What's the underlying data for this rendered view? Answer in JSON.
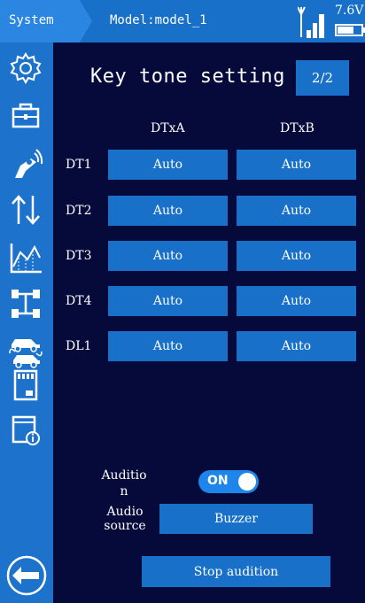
{
  "topbar": {
    "system_label": "System",
    "model_label": "Model:model_1",
    "voltage": "7.6V",
    "signal_icon": "signal-icon",
    "battery_icon": "battery-icon"
  },
  "sidebar": {
    "items": [
      {
        "icon": "gear-icon"
      },
      {
        "icon": "toolbox-icon"
      },
      {
        "icon": "transmitter-icon"
      },
      {
        "icon": "reverse-arrows-icon"
      },
      {
        "icon": "curve-chart-icon"
      },
      {
        "icon": "chassis-icon"
      },
      {
        "icon": "cars-icon"
      },
      {
        "icon": "sd-card-icon"
      },
      {
        "icon": "info-icon"
      }
    ],
    "back_icon": "back-arrow-icon"
  },
  "main": {
    "title": "Key tone setting",
    "page": "2/2",
    "columns": [
      "DTxA",
      "DTxB"
    ],
    "rows": [
      {
        "label": "DT1",
        "a": "Auto",
        "b": "Auto"
      },
      {
        "label": "DT2",
        "a": "Auto",
        "b": "Auto"
      },
      {
        "label": "DT3",
        "a": "Auto",
        "b": "Auto"
      },
      {
        "label": "DT4",
        "a": "Auto",
        "b": "Auto"
      },
      {
        "label": "DL1",
        "a": "Auto",
        "b": "Auto"
      }
    ],
    "audition_label_line1": "Auditio",
    "audition_label_line2": "n",
    "audition_toggle": "ON",
    "audio_source_line1": "Audio",
    "audio_source_line2": "source",
    "audio_source_value": "Buzzer",
    "stop_audition": "Stop audition"
  },
  "colors": {
    "accent": "#1870c8",
    "background": "#050a3a",
    "sidebar": "#1d73cb",
    "toggle": "#1e86ea"
  }
}
